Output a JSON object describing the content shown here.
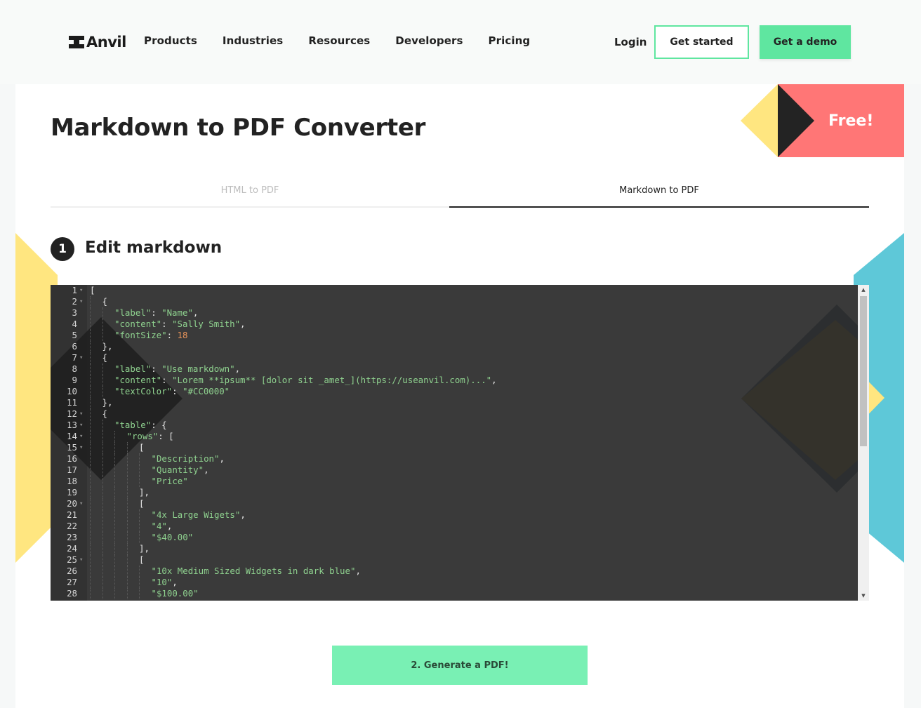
{
  "nav": {
    "logo_text": "Anvil",
    "links": [
      "Products",
      "Industries",
      "Resources",
      "Developers",
      "Pricing"
    ],
    "login": "Login",
    "get_started": "Get started",
    "get_demo": "Get a demo"
  },
  "page": {
    "title": "Markdown to PDF Converter",
    "free_badge": "Free!",
    "tabs": [
      {
        "label": "HTML to PDF",
        "active": false
      },
      {
        "label": "Markdown to PDF",
        "active": true
      }
    ],
    "step_number": "1",
    "step_title": "Edit markdown",
    "generate_button": "2. Generate a PDF!"
  },
  "editor": {
    "lines": [
      {
        "n": "1",
        "fold": true,
        "indent": 0,
        "parts": [
          [
            "p",
            "["
          ]
        ]
      },
      {
        "n": "2",
        "fold": true,
        "indent": 1,
        "parts": [
          [
            "p",
            "{"
          ]
        ]
      },
      {
        "n": "3",
        "fold": false,
        "indent": 2,
        "parts": [
          [
            "s",
            "\"label\""
          ],
          [
            "p",
            ": "
          ],
          [
            "s",
            "\"Name\""
          ],
          [
            "p",
            ","
          ]
        ]
      },
      {
        "n": "4",
        "fold": false,
        "indent": 2,
        "parts": [
          [
            "s",
            "\"content\""
          ],
          [
            "p",
            ": "
          ],
          [
            "s",
            "\"Sally Smith\""
          ],
          [
            "p",
            ","
          ]
        ]
      },
      {
        "n": "5",
        "fold": false,
        "indent": 2,
        "parts": [
          [
            "s",
            "\"fontSize\""
          ],
          [
            "p",
            ": "
          ],
          [
            "n",
            "18"
          ]
        ]
      },
      {
        "n": "6",
        "fold": false,
        "indent": 1,
        "parts": [
          [
            "p",
            "},"
          ]
        ]
      },
      {
        "n": "7",
        "fold": true,
        "indent": 1,
        "parts": [
          [
            "p",
            "{"
          ]
        ]
      },
      {
        "n": "8",
        "fold": false,
        "indent": 2,
        "parts": [
          [
            "s",
            "\"label\""
          ],
          [
            "p",
            ": "
          ],
          [
            "s",
            "\"Use markdown\""
          ],
          [
            "p",
            ","
          ]
        ]
      },
      {
        "n": "9",
        "fold": false,
        "indent": 2,
        "parts": [
          [
            "s",
            "\"content\""
          ],
          [
            "p",
            ": "
          ],
          [
            "s",
            "\"Lorem **ipsum** [dolor sit _amet_](https://useanvil.com)...\""
          ],
          [
            "p",
            ","
          ]
        ]
      },
      {
        "n": "10",
        "fold": false,
        "indent": 2,
        "parts": [
          [
            "s",
            "\"textColor\""
          ],
          [
            "p",
            ": "
          ],
          [
            "s",
            "\"#CC0000\""
          ]
        ]
      },
      {
        "n": "11",
        "fold": false,
        "indent": 1,
        "parts": [
          [
            "p",
            "},"
          ]
        ]
      },
      {
        "n": "12",
        "fold": true,
        "indent": 1,
        "parts": [
          [
            "p",
            "{"
          ]
        ]
      },
      {
        "n": "13",
        "fold": true,
        "indent": 2,
        "parts": [
          [
            "s",
            "\"table\""
          ],
          [
            "p",
            ": {"
          ]
        ]
      },
      {
        "n": "14",
        "fold": true,
        "indent": 3,
        "parts": [
          [
            "s",
            "\"rows\""
          ],
          [
            "p",
            ": ["
          ]
        ]
      },
      {
        "n": "15",
        "fold": true,
        "indent": 4,
        "parts": [
          [
            "p",
            "["
          ]
        ]
      },
      {
        "n": "16",
        "fold": false,
        "indent": 5,
        "parts": [
          [
            "s",
            "\"Description\""
          ],
          [
            "p",
            ","
          ]
        ]
      },
      {
        "n": "17",
        "fold": false,
        "indent": 5,
        "parts": [
          [
            "s",
            "\"Quantity\""
          ],
          [
            "p",
            ","
          ]
        ]
      },
      {
        "n": "18",
        "fold": false,
        "indent": 5,
        "parts": [
          [
            "s",
            "\"Price\""
          ]
        ]
      },
      {
        "n": "19",
        "fold": false,
        "indent": 4,
        "parts": [
          [
            "p",
            "],"
          ]
        ]
      },
      {
        "n": "20",
        "fold": true,
        "indent": 4,
        "parts": [
          [
            "p",
            "["
          ]
        ]
      },
      {
        "n": "21",
        "fold": false,
        "indent": 5,
        "parts": [
          [
            "s",
            "\"4x Large Wigets\""
          ],
          [
            "p",
            ","
          ]
        ]
      },
      {
        "n": "22",
        "fold": false,
        "indent": 5,
        "parts": [
          [
            "s",
            "\"4\""
          ],
          [
            "p",
            ","
          ]
        ]
      },
      {
        "n": "23",
        "fold": false,
        "indent": 5,
        "parts": [
          [
            "s",
            "\"$40.00\""
          ]
        ]
      },
      {
        "n": "24",
        "fold": false,
        "indent": 4,
        "parts": [
          [
            "p",
            "],"
          ]
        ]
      },
      {
        "n": "25",
        "fold": true,
        "indent": 4,
        "parts": [
          [
            "p",
            "["
          ]
        ]
      },
      {
        "n": "26",
        "fold": false,
        "indent": 5,
        "parts": [
          [
            "s",
            "\"10x Medium Sized Widgets in dark blue\""
          ],
          [
            "p",
            ","
          ]
        ]
      },
      {
        "n": "27",
        "fold": false,
        "indent": 5,
        "parts": [
          [
            "s",
            "\"10\""
          ],
          [
            "p",
            ","
          ]
        ]
      },
      {
        "n": "28",
        "fold": false,
        "indent": 5,
        "parts": [
          [
            "s",
            "\"$100.00\""
          ]
        ]
      }
    ]
  },
  "colors": {
    "accent_green": "#5fe6a0",
    "generate_green": "#79f0b4",
    "badge_red": "#ff7676",
    "badge_yellow": "#ffe680",
    "deco_blue": "#5ec8d8",
    "editor_bg": "#3a3a3a",
    "string_green": "#8fd28f",
    "number_orange": "#e8945a"
  }
}
